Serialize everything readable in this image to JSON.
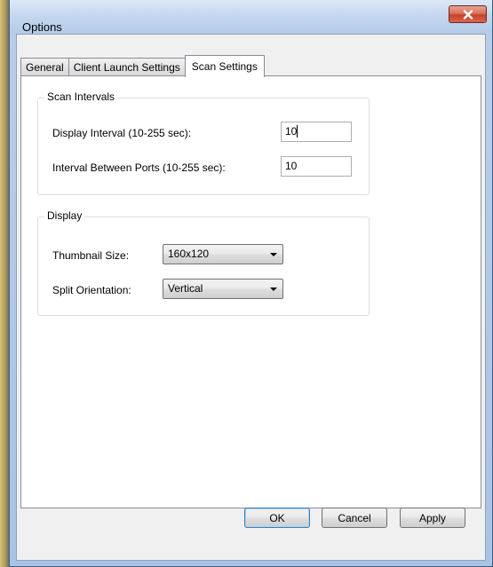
{
  "window": {
    "title": "Options",
    "close_glyph": "x"
  },
  "tabs": [
    {
      "label": "General",
      "active": false
    },
    {
      "label": "Client Launch Settings",
      "active": false
    },
    {
      "label": "Scan Settings",
      "active": true
    }
  ],
  "scan_intervals": {
    "title": "Scan Intervals",
    "display_interval_label": "Display Interval (10-255 sec):",
    "display_interval_value": "10",
    "ports_interval_label": "Interval Between Ports (10-255 sec):",
    "ports_interval_value": "10"
  },
  "display": {
    "title": "Display",
    "thumbnail_label": "Thumbnail Size:",
    "thumbnail_value": "160x120",
    "split_label": "Split Orientation:",
    "split_value": "Vertical"
  },
  "buttons": {
    "ok": "OK",
    "cancel": "Cancel",
    "apply": "Apply"
  },
  "colors": {
    "close_button": "#c7422a",
    "default_button_border": "#3c7fb1"
  }
}
